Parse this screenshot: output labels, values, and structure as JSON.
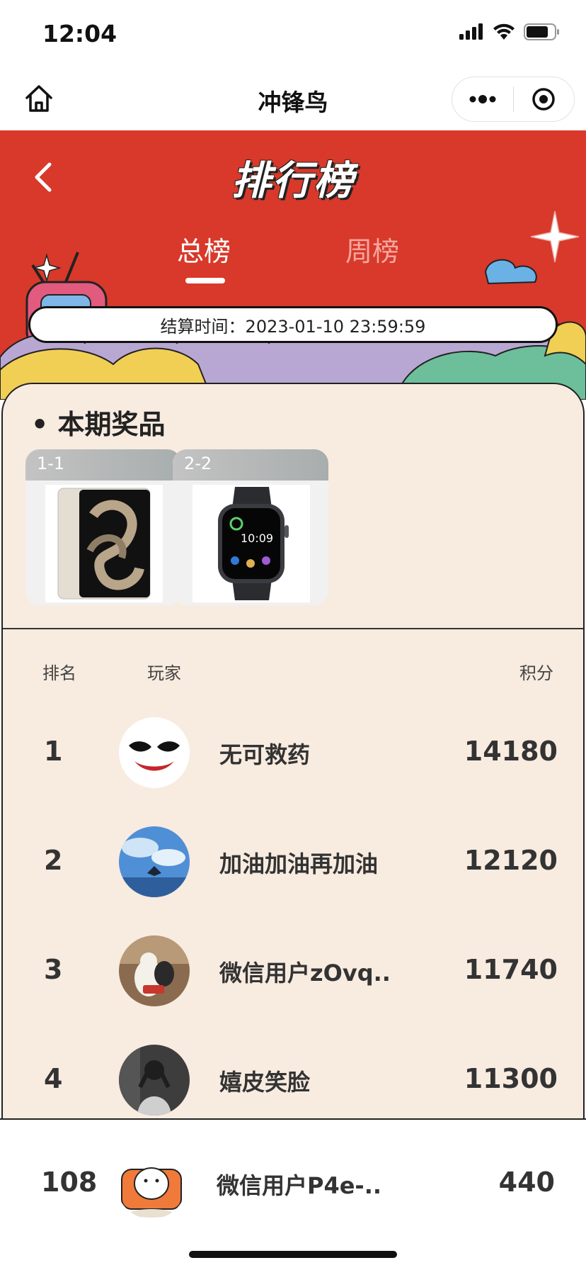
{
  "status": {
    "time": "12:04"
  },
  "nav": {
    "title": "冲锋鸟"
  },
  "hero": {
    "title": "排行榜",
    "tabs": [
      {
        "label": "总榜",
        "active": true
      },
      {
        "label": "周榜",
        "active": false
      }
    ],
    "settle_time": "结算时间：2023-01-10 23:59:59"
  },
  "prizes": {
    "heading": "• 本期奖品",
    "items": [
      {
        "label": "1-1",
        "icon": "tablet-icon"
      },
      {
        "label": "2-2",
        "icon": "smartwatch-icon"
      }
    ]
  },
  "table": {
    "headers": {
      "rank": "排名",
      "player": "玩家",
      "score": "积分"
    },
    "rows": [
      {
        "rank": "1",
        "name": "无可救药",
        "score": "14180"
      },
      {
        "rank": "2",
        "name": "加油加油再加油",
        "score": "12120"
      },
      {
        "rank": "3",
        "name": "微信用户zOvq..",
        "score": "11740"
      },
      {
        "rank": "4",
        "name": "嬉皮笑脸",
        "score": "11300"
      }
    ]
  },
  "me": {
    "rank": "108",
    "name": "微信用户P4e-..",
    "score": "440"
  },
  "colors": {
    "hero_red": "#d8392a",
    "panel": "#f8ebe0",
    "tab_inactive": "#f5a8a0"
  }
}
